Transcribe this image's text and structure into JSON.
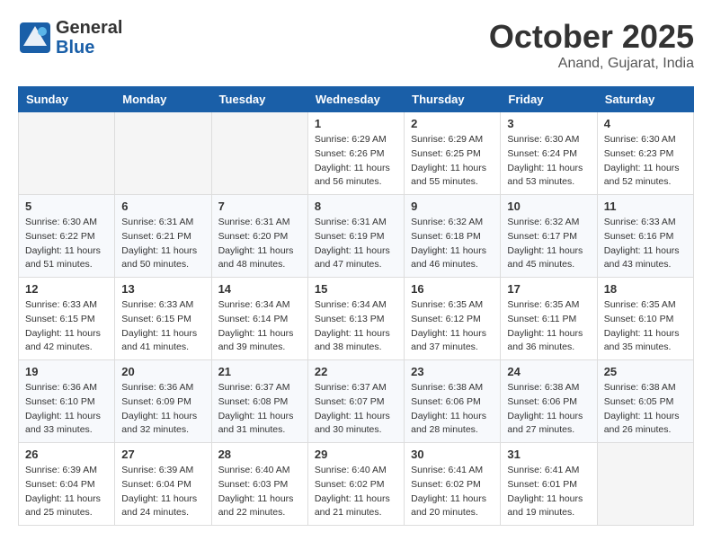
{
  "header": {
    "logo_line1": "General",
    "logo_line2": "Blue",
    "month": "October 2025",
    "location": "Anand, Gujarat, India"
  },
  "days_of_week": [
    "Sunday",
    "Monday",
    "Tuesday",
    "Wednesday",
    "Thursday",
    "Friday",
    "Saturday"
  ],
  "weeks": [
    [
      {
        "day": "",
        "info": ""
      },
      {
        "day": "",
        "info": ""
      },
      {
        "day": "",
        "info": ""
      },
      {
        "day": "1",
        "info": "Sunrise: 6:29 AM\nSunset: 6:26 PM\nDaylight: 11 hours and 56 minutes."
      },
      {
        "day": "2",
        "info": "Sunrise: 6:29 AM\nSunset: 6:25 PM\nDaylight: 11 hours and 55 minutes."
      },
      {
        "day": "3",
        "info": "Sunrise: 6:30 AM\nSunset: 6:24 PM\nDaylight: 11 hours and 53 minutes."
      },
      {
        "day": "4",
        "info": "Sunrise: 6:30 AM\nSunset: 6:23 PM\nDaylight: 11 hours and 52 minutes."
      }
    ],
    [
      {
        "day": "5",
        "info": "Sunrise: 6:30 AM\nSunset: 6:22 PM\nDaylight: 11 hours and 51 minutes."
      },
      {
        "day": "6",
        "info": "Sunrise: 6:31 AM\nSunset: 6:21 PM\nDaylight: 11 hours and 50 minutes."
      },
      {
        "day": "7",
        "info": "Sunrise: 6:31 AM\nSunset: 6:20 PM\nDaylight: 11 hours and 48 minutes."
      },
      {
        "day": "8",
        "info": "Sunrise: 6:31 AM\nSunset: 6:19 PM\nDaylight: 11 hours and 47 minutes."
      },
      {
        "day": "9",
        "info": "Sunrise: 6:32 AM\nSunset: 6:18 PM\nDaylight: 11 hours and 46 minutes."
      },
      {
        "day": "10",
        "info": "Sunrise: 6:32 AM\nSunset: 6:17 PM\nDaylight: 11 hours and 45 minutes."
      },
      {
        "day": "11",
        "info": "Sunrise: 6:33 AM\nSunset: 6:16 PM\nDaylight: 11 hours and 43 minutes."
      }
    ],
    [
      {
        "day": "12",
        "info": "Sunrise: 6:33 AM\nSunset: 6:15 PM\nDaylight: 11 hours and 42 minutes."
      },
      {
        "day": "13",
        "info": "Sunrise: 6:33 AM\nSunset: 6:15 PM\nDaylight: 11 hours and 41 minutes."
      },
      {
        "day": "14",
        "info": "Sunrise: 6:34 AM\nSunset: 6:14 PM\nDaylight: 11 hours and 39 minutes."
      },
      {
        "day": "15",
        "info": "Sunrise: 6:34 AM\nSunset: 6:13 PM\nDaylight: 11 hours and 38 minutes."
      },
      {
        "day": "16",
        "info": "Sunrise: 6:35 AM\nSunset: 6:12 PM\nDaylight: 11 hours and 37 minutes."
      },
      {
        "day": "17",
        "info": "Sunrise: 6:35 AM\nSunset: 6:11 PM\nDaylight: 11 hours and 36 minutes."
      },
      {
        "day": "18",
        "info": "Sunrise: 6:35 AM\nSunset: 6:10 PM\nDaylight: 11 hours and 35 minutes."
      }
    ],
    [
      {
        "day": "19",
        "info": "Sunrise: 6:36 AM\nSunset: 6:10 PM\nDaylight: 11 hours and 33 minutes."
      },
      {
        "day": "20",
        "info": "Sunrise: 6:36 AM\nSunset: 6:09 PM\nDaylight: 11 hours and 32 minutes."
      },
      {
        "day": "21",
        "info": "Sunrise: 6:37 AM\nSunset: 6:08 PM\nDaylight: 11 hours and 31 minutes."
      },
      {
        "day": "22",
        "info": "Sunrise: 6:37 AM\nSunset: 6:07 PM\nDaylight: 11 hours and 30 minutes."
      },
      {
        "day": "23",
        "info": "Sunrise: 6:38 AM\nSunset: 6:06 PM\nDaylight: 11 hours and 28 minutes."
      },
      {
        "day": "24",
        "info": "Sunrise: 6:38 AM\nSunset: 6:06 PM\nDaylight: 11 hours and 27 minutes."
      },
      {
        "day": "25",
        "info": "Sunrise: 6:38 AM\nSunset: 6:05 PM\nDaylight: 11 hours and 26 minutes."
      }
    ],
    [
      {
        "day": "26",
        "info": "Sunrise: 6:39 AM\nSunset: 6:04 PM\nDaylight: 11 hours and 25 minutes."
      },
      {
        "day": "27",
        "info": "Sunrise: 6:39 AM\nSunset: 6:04 PM\nDaylight: 11 hours and 24 minutes."
      },
      {
        "day": "28",
        "info": "Sunrise: 6:40 AM\nSunset: 6:03 PM\nDaylight: 11 hours and 22 minutes."
      },
      {
        "day": "29",
        "info": "Sunrise: 6:40 AM\nSunset: 6:02 PM\nDaylight: 11 hours and 21 minutes."
      },
      {
        "day": "30",
        "info": "Sunrise: 6:41 AM\nSunset: 6:02 PM\nDaylight: 11 hours and 20 minutes."
      },
      {
        "day": "31",
        "info": "Sunrise: 6:41 AM\nSunset: 6:01 PM\nDaylight: 11 hours and 19 minutes."
      },
      {
        "day": "",
        "info": ""
      }
    ]
  ]
}
